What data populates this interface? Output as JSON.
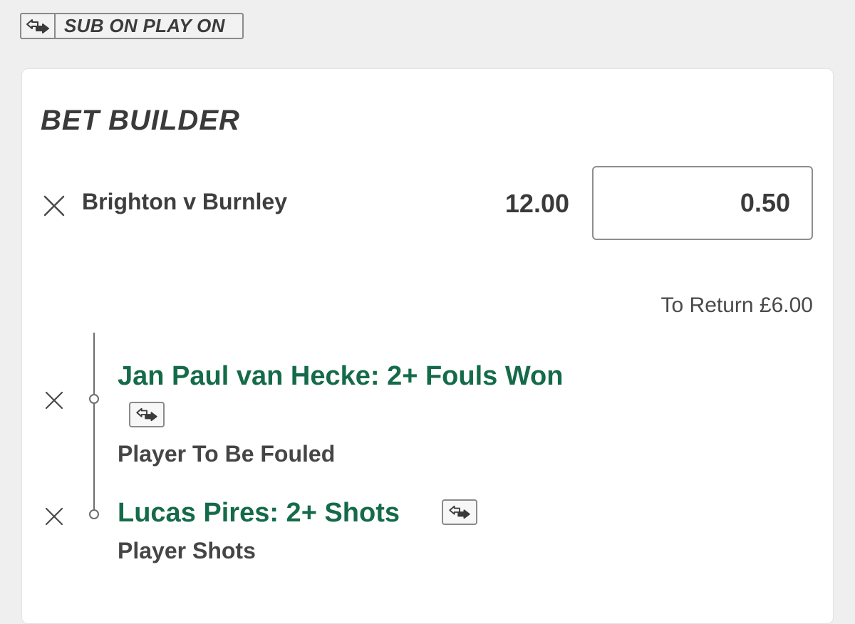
{
  "badge": {
    "label": "SUB ON PLAY ON",
    "icon": "sub-swap-icon"
  },
  "bet_builder": {
    "title": "BET BUILDER",
    "match": "Brighton v Burnley",
    "odds": "12.00",
    "stake": "0.50",
    "to_return": "To Return £6.00",
    "selections": [
      {
        "title": "Jan Paul van Hecke: 2+ Fouls Won",
        "market": "Player To Be Fouled",
        "icon": "sub-swap-icon"
      },
      {
        "title": "Lucas Pires: 2+ Shots",
        "market": "Player Shots",
        "icon": "sub-swap-icon"
      }
    ]
  },
  "colors": {
    "accent_green": "#156b49",
    "background": "#efefef",
    "card": "#ffffff",
    "text": "#3a3a3a"
  }
}
